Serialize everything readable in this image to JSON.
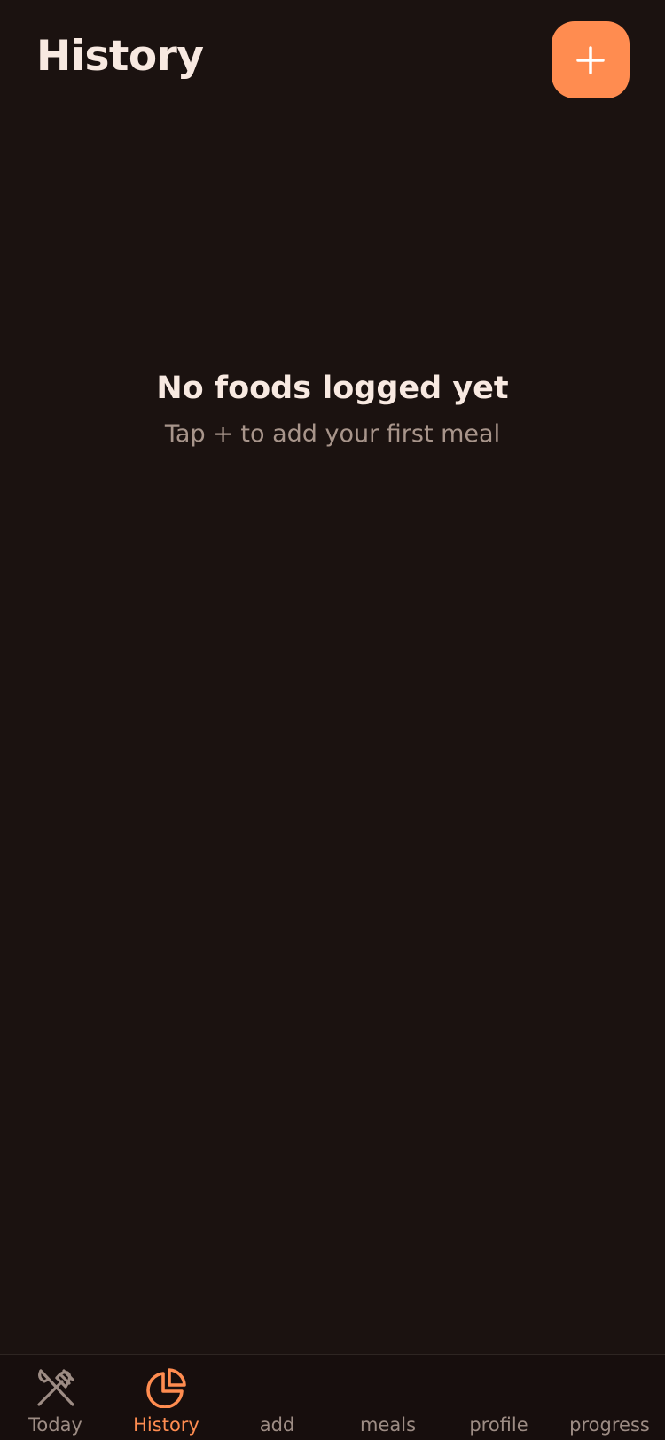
{
  "header": {
    "title": "History",
    "add_button_icon": "plus-icon"
  },
  "empty_state": {
    "title": "No foods logged yet",
    "subtitle": "Tap + to add your first meal"
  },
  "tab_bar": {
    "active_tab": "History",
    "tabs": [
      {
        "label": "Today",
        "icon": "fork-knife-icon",
        "active": false
      },
      {
        "label": "History",
        "icon": "pie-chart-icon",
        "active": true
      },
      {
        "label": "add",
        "icon": "",
        "active": false
      },
      {
        "label": "meals",
        "icon": "",
        "active": false
      },
      {
        "label": "profile",
        "icon": "",
        "active": false
      },
      {
        "label": "progress",
        "icon": "",
        "active": false
      }
    ]
  },
  "colors": {
    "background": "#1b1210",
    "tab_bar_background": "#170e0d",
    "accent": "#ff8c50",
    "title_text": "#f8e9e1",
    "secondary_text": "#a8958b",
    "inactive_tab": "#9d8c84"
  }
}
